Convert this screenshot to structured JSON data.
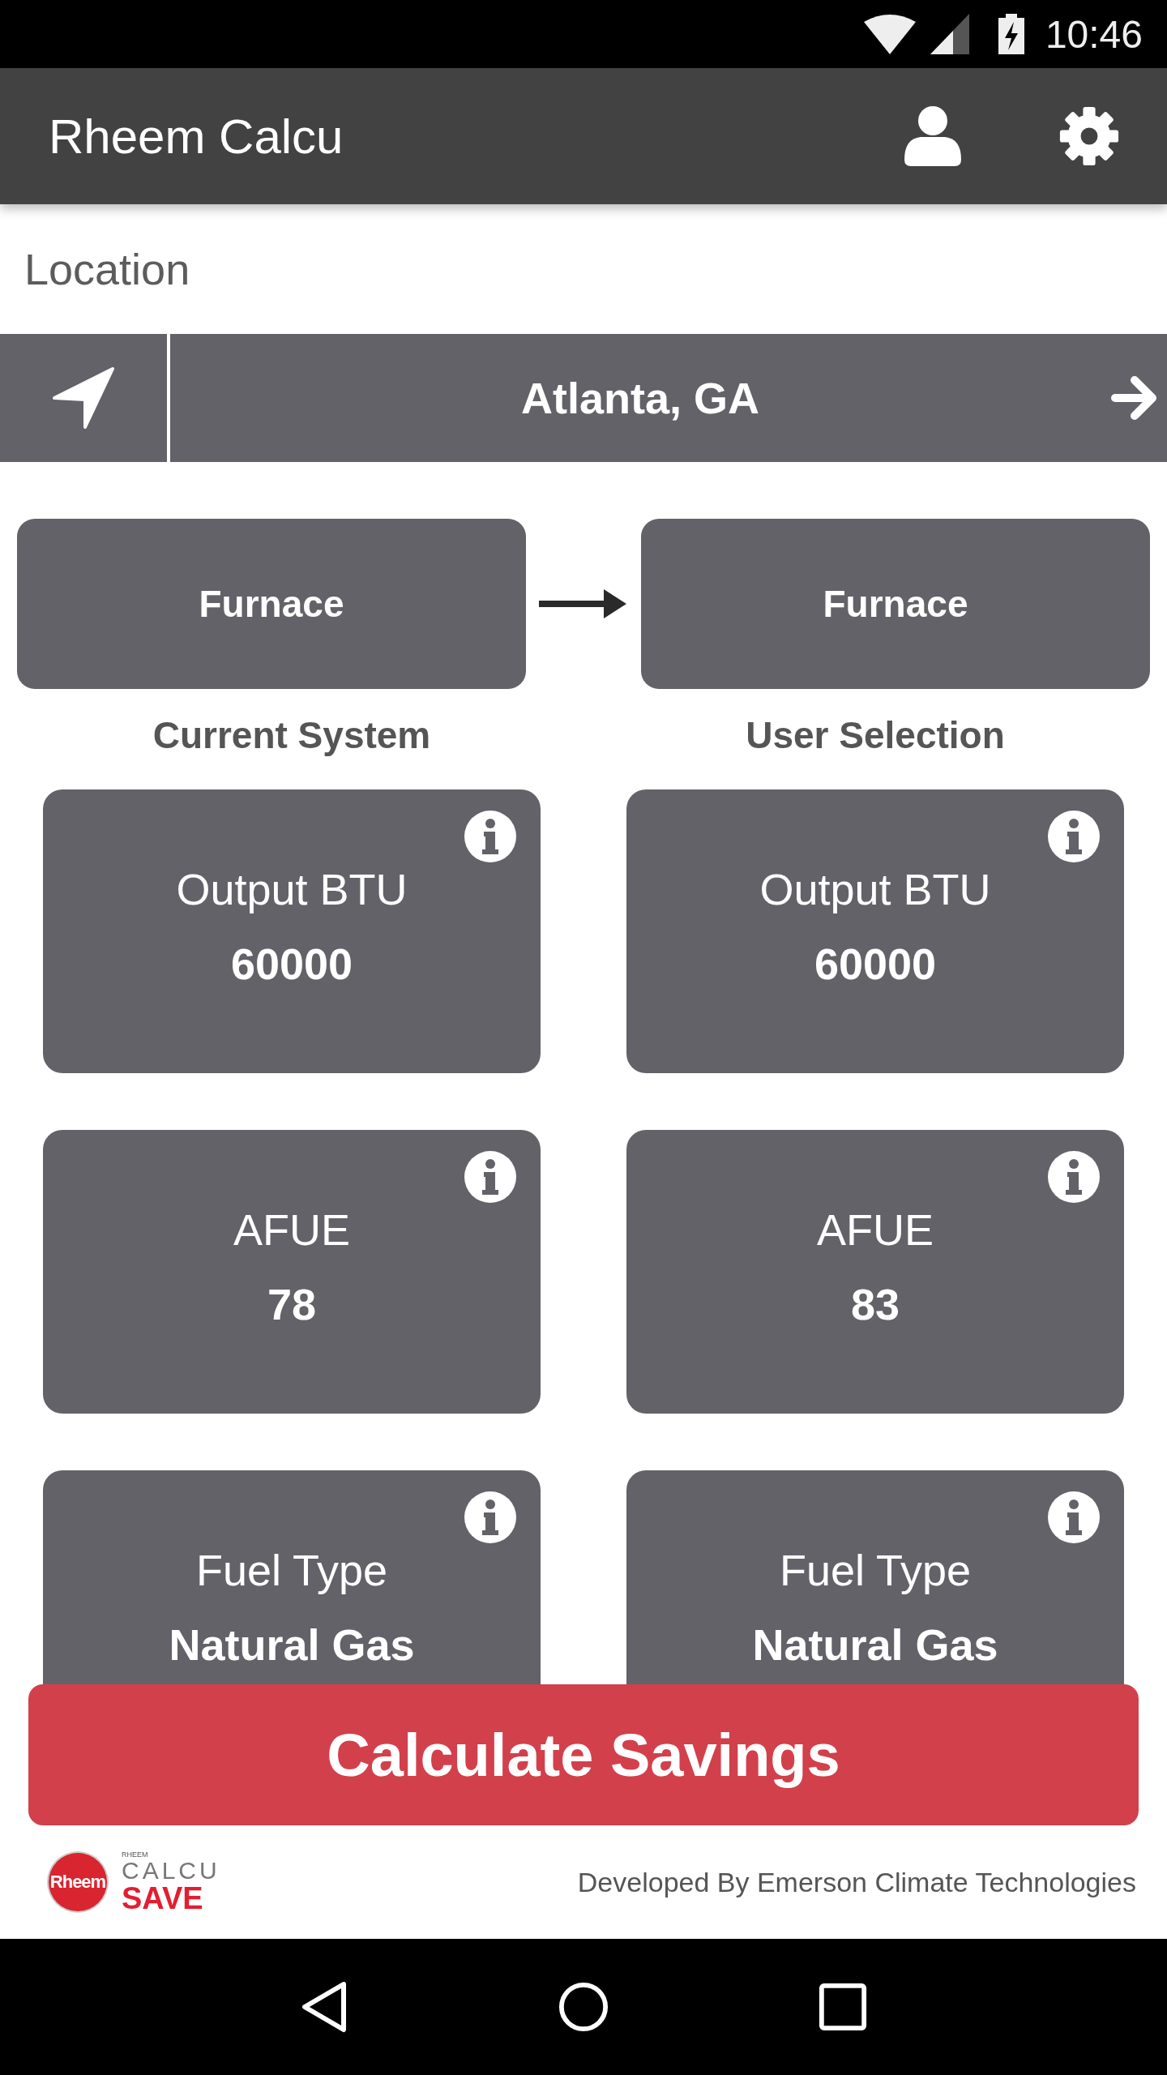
{
  "status_bar": {
    "time": "10:46"
  },
  "app_bar": {
    "title": "Rheem Calcu"
  },
  "location": {
    "label": "Location",
    "city": "Atlanta, GA"
  },
  "systems": [
    {
      "name": "Furnace",
      "heading": "Current System",
      "specs": [
        {
          "label": "Output BTU",
          "value": "60000"
        },
        {
          "label": "AFUE",
          "value": "78"
        },
        {
          "label": "Fuel Type",
          "value": "Natural Gas"
        }
      ]
    },
    {
      "name": "Furnace",
      "heading": "User Selection",
      "specs": [
        {
          "label": "Output BTU",
          "value": "60000"
        },
        {
          "label": "AFUE",
          "value": "83"
        },
        {
          "label": "Fuel Type",
          "value": "Natural Gas"
        }
      ]
    }
  ],
  "calculate_button": "Calculate Savings",
  "footer": {
    "logo_badge": "Rheem",
    "logo_brand": "RHEEM",
    "logo_line1": "CALCU",
    "logo_line2": "SAVE",
    "credit": "Developed By Emerson Climate Technologies"
  }
}
